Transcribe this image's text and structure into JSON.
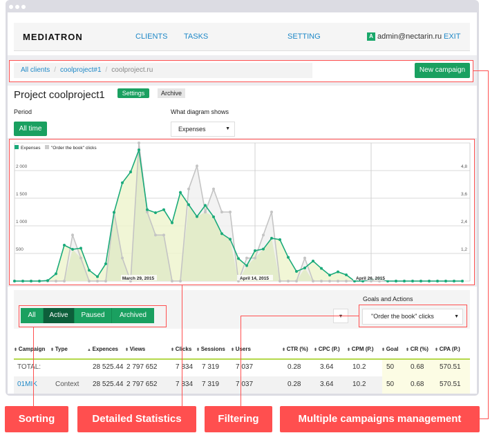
{
  "nav": {
    "logo": "MEDIATRON",
    "links": [
      "CLIENTS",
      "TASKS",
      "SETTING"
    ],
    "user_badge": "A",
    "user_email": "admin@nectarin.ru",
    "exit": "EXIT"
  },
  "breadcrumb": {
    "items": [
      "All clients",
      "coolproject#1",
      "coolproject.ru"
    ],
    "new_campaign": "New campaign"
  },
  "project": {
    "title": "Project coolproject1",
    "settings": "Settings",
    "archive": "Archive"
  },
  "period": {
    "label": "Period",
    "value": "All time"
  },
  "diagram": {
    "label": "What diagram shows",
    "value": "Expenses"
  },
  "chart_data": {
    "type": "area",
    "legend": [
      "Expenses",
      "\"Order the book\" clicks"
    ],
    "legend_position": "top-left",
    "x_tick_labels": [
      {
        "index": 15,
        "label": "March 29, 2015"
      },
      {
        "index": 29,
        "label": "April 14, 2015"
      },
      {
        "index": 43,
        "label": "April 26, 2015"
      }
    ],
    "y_left_ticks": [
      "500",
      "1 000",
      "1 500",
      "2 000"
    ],
    "y_left_range": [
      0,
      2500
    ],
    "y_right_ticks": [
      "1,2",
      "2,4",
      "3,6",
      "4,8"
    ],
    "y_right_range": [
      0,
      6
    ],
    "grid": true,
    "colors": {
      "expenses": "#1aaa7a",
      "expenses_fill": "#eef5cf",
      "clicks": "#c4c4c4",
      "clicks_fill": "#f1f1f1"
    },
    "series": [
      {
        "name": "Expenses",
        "axis": "left",
        "values": [
          0,
          0,
          0,
          0,
          10,
          133,
          650,
          575,
          596,
          196,
          79,
          313,
          1242,
          1779,
          1975,
          2375,
          1292,
          1238,
          1292,
          1054,
          1604,
          1383,
          1167,
          1371,
          1163,
          858,
          758,
          408,
          279,
          550,
          579,
          775,
          750,
          429,
          175,
          238,
          363,
          229,
          108,
          167,
          113,
          0,
          0,
          33,
          42,
          0,
          0,
          0,
          0,
          0,
          0,
          0,
          0,
          0,
          0
        ]
      },
      {
        "name": "\"Order the book\" clicks",
        "axis": "right",
        "values": [
          0,
          0,
          0,
          0,
          0,
          0,
          0,
          2,
          1,
          0,
          0,
          0,
          3,
          1,
          0,
          6,
          3,
          2,
          2,
          0,
          0,
          4,
          5,
          3,
          4,
          3,
          3,
          0,
          1,
          1,
          2,
          3,
          0,
          0,
          0,
          1,
          0,
          0,
          0,
          0,
          0,
          0,
          0,
          0,
          0,
          0,
          0,
          0,
          0,
          0,
          0,
          0,
          0,
          0,
          0
        ]
      }
    ]
  },
  "filters": {
    "status": [
      "All",
      "Active",
      "Paused",
      "Archived"
    ],
    "active_status": "Active",
    "small_dropdown": "▾",
    "goals_label": "Goals and Actions",
    "goals_value": "\"Order the book\" clicks"
  },
  "table": {
    "headers": [
      "Campaign",
      "Type",
      "Expences",
      "Views",
      "Clicks",
      "Sessions",
      "Users",
      "CTR (%)",
      "CPC (P.)",
      "CPM (P.)",
      "Goal",
      "CR (%)",
      "CPA (P.)"
    ],
    "total": {
      "label": "TOTAL:",
      "values": [
        "28 525.44",
        "2 797 652",
        "7 834",
        "7 319",
        "7 037",
        "0.28",
        "3.64",
        "10.2",
        "50",
        "0.68",
        "570.51"
      ]
    },
    "rows": [
      {
        "campaign": "01MIK",
        "type": "Context",
        "values": [
          "28 525.44",
          "2 797 652",
          "7 834",
          "7 319",
          "7 037",
          "0.28",
          "3.64",
          "10.2",
          "50",
          "0.68",
          "570.51"
        ]
      }
    ]
  },
  "annotations": [
    "Sorting",
    "Detailed Statistics",
    "Filtering",
    "Multiple campaigns management"
  ]
}
